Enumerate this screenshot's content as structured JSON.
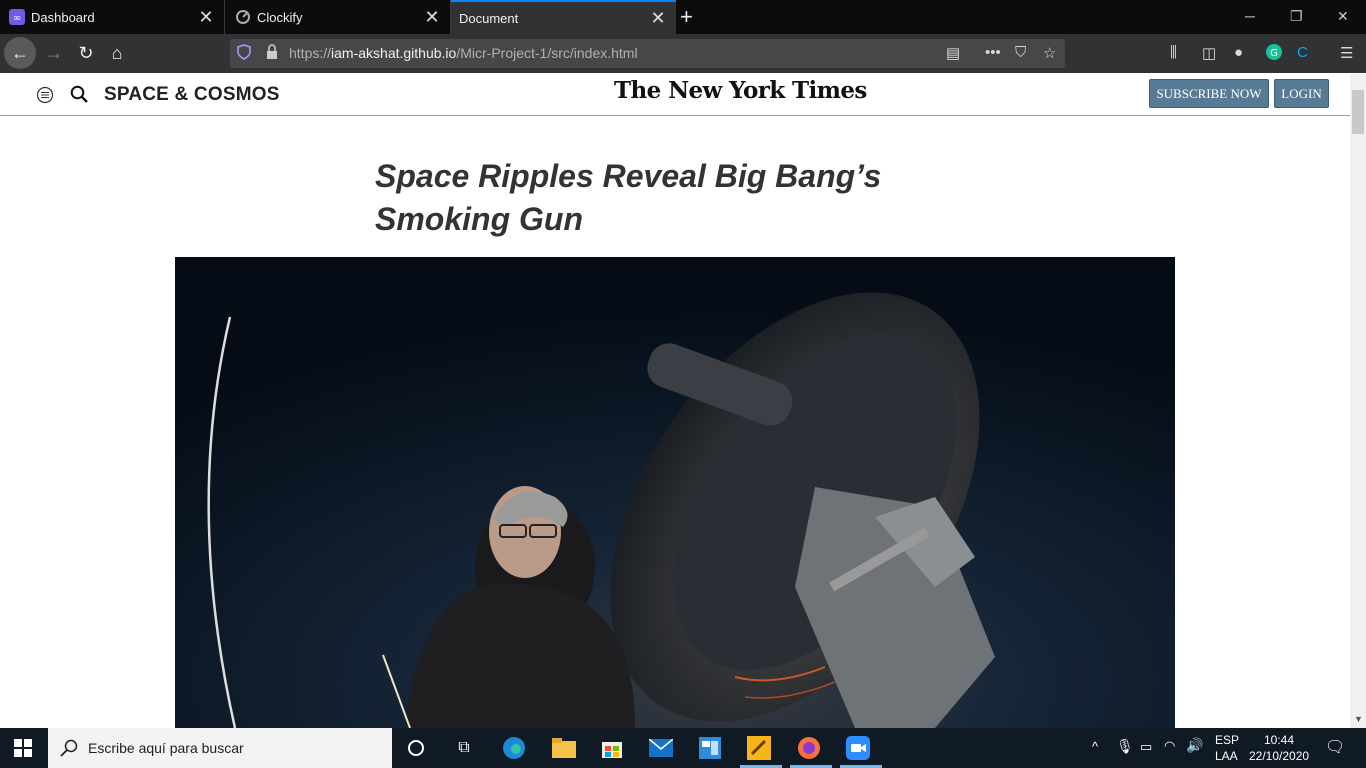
{
  "browser": {
    "tabs": [
      {
        "title": "Dashboard",
        "icon": "dashboard-icon"
      },
      {
        "title": "Clockify",
        "icon": "clockify-icon"
      },
      {
        "title": "Document",
        "icon": "none"
      }
    ],
    "url_prefix": "https://",
    "url_domain": "iam-akshat.github.io",
    "url_path": "/Micr-Project-1/src/index.html"
  },
  "page": {
    "section": "SPACE & COSMOS",
    "masthead": "The New York Times",
    "subscribe_label": "SUBSCRIBE NOW",
    "login_label": "LOGIN",
    "headline": "Space Ripples Reveal Big Bang’s Smoking Gun"
  },
  "taskbar": {
    "search_placeholder": "Escribe aquí para buscar",
    "lang_top": "ESP",
    "lang_bottom": "LAA",
    "time": "10:44",
    "date": "22/10/2020"
  },
  "colors": {
    "accent": "#0a84ff",
    "button_bg": "#567b95",
    "tab_bg": "#0c0c0d",
    "toolbar_bg": "#323234"
  }
}
